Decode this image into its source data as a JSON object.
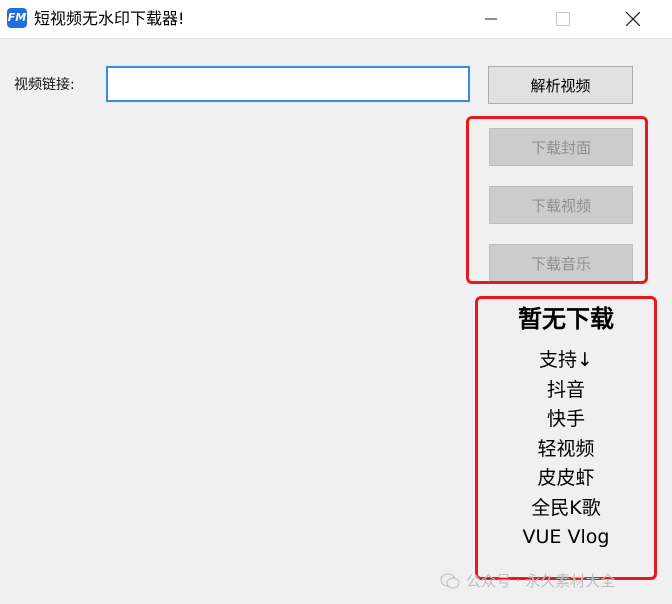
{
  "window": {
    "title": "短视频无水印下载器!",
    "icon_text": "FM"
  },
  "form": {
    "url_label": "视频链接:",
    "url_value": "",
    "parse_button": "解析视频"
  },
  "downloads": {
    "cover_button": "下载封面",
    "video_button": "下载视频",
    "audio_button": "下载音乐"
  },
  "info": {
    "status": "暂无下载",
    "supported_header": "支持↓",
    "platforms": [
      "抖音",
      "快手",
      "轻视频",
      "皮皮虾",
      "全民K歌",
      "VUE Vlog"
    ]
  },
  "watermark": {
    "text": "公众号 · 永久素材大全"
  },
  "colors": {
    "highlight_border": "#e8181f",
    "input_focus": "#3c8be0",
    "app_icon": "#1e6fe0"
  }
}
